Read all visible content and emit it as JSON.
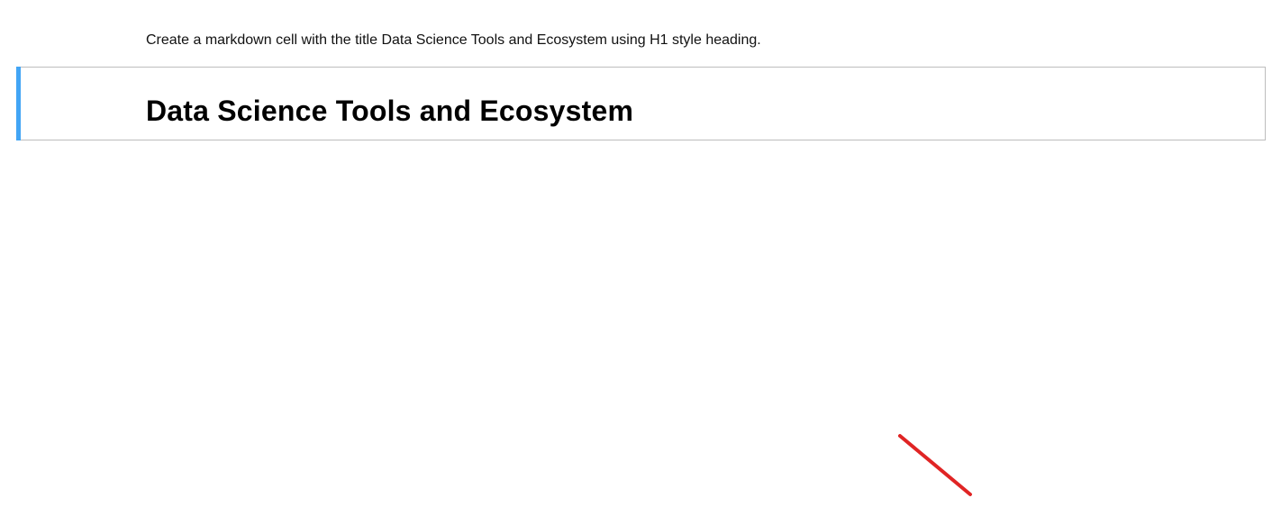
{
  "notebook": {
    "instruction_cell": {
      "text": "Create a markdown cell with the title Data Science Tools and Ecosystem using H1 style heading."
    },
    "heading_cell": {
      "heading": "Data Science Tools and Ecosystem",
      "selected": true
    }
  },
  "colors": {
    "selection_bar": "#42a5f5",
    "cell_border": "#bdbdbd",
    "annotation_line": "#e02424"
  },
  "icons": {
    "annotation": "red-diagonal-line"
  }
}
